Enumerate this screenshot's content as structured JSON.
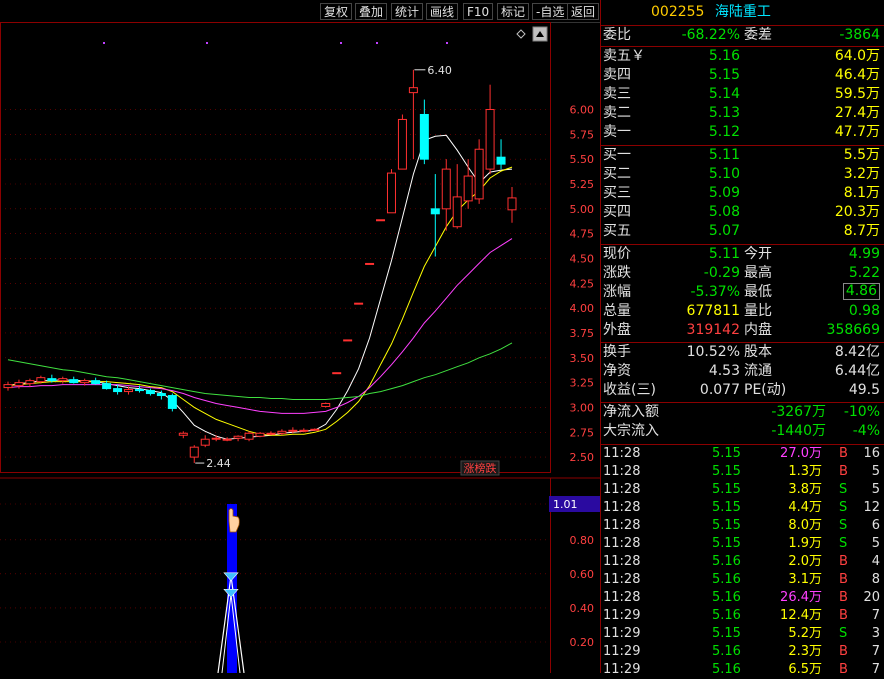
{
  "toolbar": {
    "buttons": [
      "复权",
      "叠加",
      "统计",
      "画线",
      "F10",
      "标记",
      "-自选",
      "返回"
    ]
  },
  "stock": {
    "code": "002255",
    "name": "海陆重工"
  },
  "weibi": {
    "label1": "委比",
    "value1": "-68.22%",
    "label2": "委差",
    "value2": "-3864"
  },
  "sell": [
    {
      "label": "卖五￥",
      "price": "5.16",
      "vol": "64.0万"
    },
    {
      "label": "卖四",
      "price": "5.15",
      "vol": "46.4万"
    },
    {
      "label": "卖三",
      "price": "5.14",
      "vol": "59.5万"
    },
    {
      "label": "卖二",
      "price": "5.13",
      "vol": "27.4万"
    },
    {
      "label": "卖一",
      "price": "5.12",
      "vol": "47.7万"
    }
  ],
  "buy": [
    {
      "label": "买一",
      "price": "5.11",
      "vol": "5.5万"
    },
    {
      "label": "买二",
      "price": "5.10",
      "vol": "3.2万"
    },
    {
      "label": "买三",
      "price": "5.09",
      "vol": "8.1万"
    },
    {
      "label": "买四",
      "price": "5.08",
      "vol": "20.3万"
    },
    {
      "label": "买五",
      "price": "5.07",
      "vol": "8.7万"
    }
  ],
  "quote": [
    {
      "l1": "现价",
      "v1": "5.11",
      "c1": "g",
      "l2": "今开",
      "v2": "4.99",
      "c2": "g"
    },
    {
      "l1": "涨跌",
      "v1": "-0.29",
      "c1": "g",
      "l2": "最高",
      "v2": "5.22",
      "c2": "g"
    },
    {
      "l1": "涨幅",
      "v1": "-5.37%",
      "c1": "g",
      "l2": "最低",
      "v2": "4.86",
      "c2": "g"
    },
    {
      "l1": "总量",
      "v1": "677811",
      "c1": "y",
      "l2": "量比",
      "v2": "0.98",
      "c2": "g"
    },
    {
      "l1": "外盘",
      "v1": "319142",
      "c1": "r",
      "l2": "内盘",
      "v2": "358669",
      "c2": "g"
    }
  ],
  "fund": [
    {
      "l1": "换手",
      "v1": "10.52%",
      "l2": "股本",
      "v2": "8.42亿"
    },
    {
      "l1": "净资",
      "v1": "4.53",
      "l2": "流通",
      "v2": "6.44亿"
    },
    {
      "l1": "收益(三)",
      "v1": "0.077",
      "l2": "PE(动)",
      "v2": "49.5"
    }
  ],
  "flow": [
    {
      "label": "净流入额",
      "value": "-3267万",
      "pct": "-10%"
    },
    {
      "label": "大宗流入",
      "value": "-1440万",
      "pct": "-4%"
    }
  ],
  "ticks": [
    {
      "t": "11:28",
      "p": "5.15",
      "v": "27.0万",
      "vc": "m",
      "s": "B",
      "n": "16"
    },
    {
      "t": "11:28",
      "p": "5.15",
      "v": "1.3万",
      "vc": "y",
      "s": "B",
      "n": "5"
    },
    {
      "t": "11:28",
      "p": "5.15",
      "v": "3.8万",
      "vc": "y",
      "s": "S",
      "n": "5"
    },
    {
      "t": "11:28",
      "p": "5.15",
      "v": "4.4万",
      "vc": "y",
      "s": "S",
      "n": "12"
    },
    {
      "t": "11:28",
      "p": "5.15",
      "v": "8.0万",
      "vc": "y",
      "s": "S",
      "n": "6"
    },
    {
      "t": "11:28",
      "p": "5.15",
      "v": "1.9万",
      "vc": "y",
      "s": "S",
      "n": "5"
    },
    {
      "t": "11:28",
      "p": "5.16",
      "v": "2.0万",
      "vc": "y",
      "s": "B",
      "n": "4"
    },
    {
      "t": "11:28",
      "p": "5.16",
      "v": "3.1万",
      "vc": "y",
      "s": "B",
      "n": "8"
    },
    {
      "t": "11:28",
      "p": "5.16",
      "v": "26.4万",
      "vc": "m",
      "s": "B",
      "n": "20"
    },
    {
      "t": "11:29",
      "p": "5.16",
      "v": "12.4万",
      "vc": "y",
      "s": "B",
      "n": "7"
    },
    {
      "t": "11:29",
      "p": "5.15",
      "v": "5.2万",
      "vc": "y",
      "s": "S",
      "n": "3"
    },
    {
      "t": "11:29",
      "p": "5.16",
      "v": "2.3万",
      "vc": "y",
      "s": "B",
      "n": "7"
    },
    {
      "t": "11:29",
      "p": "5.16",
      "v": "6.5万",
      "vc": "y",
      "s": "B",
      "n": "7"
    }
  ],
  "chart_data": {
    "type": "candlestick",
    "price_axis": [
      "6.00",
      "5.75",
      "5.50",
      "5.25",
      "5.00",
      "4.75",
      "4.50",
      "4.25",
      "4.00",
      "3.75",
      "3.50",
      "3.25",
      "3.00",
      "2.75",
      "2.50"
    ],
    "high_label": "6.40",
    "low_label": "2.44",
    "tag": "涨榜跌",
    "candles": [
      {
        "o": 3.2,
        "h": 3.26,
        "l": 3.17,
        "c": 3.23
      },
      {
        "o": 3.22,
        "h": 3.28,
        "l": 3.19,
        "c": 3.25
      },
      {
        "o": 3.24,
        "h": 3.29,
        "l": 3.21,
        "c": 3.27
      },
      {
        "o": 3.26,
        "h": 3.32,
        "l": 3.24,
        "c": 3.3
      },
      {
        "o": 3.29,
        "h": 3.33,
        "l": 3.25,
        "c": 3.27
      },
      {
        "o": 3.27,
        "h": 3.31,
        "l": 3.24,
        "c": 3.29
      },
      {
        "o": 3.28,
        "h": 3.31,
        "l": 3.24,
        "c": 3.25
      },
      {
        "o": 3.25,
        "h": 3.29,
        "l": 3.22,
        "c": 3.27
      },
      {
        "o": 3.27,
        "h": 3.3,
        "l": 3.23,
        "c": 3.24
      },
      {
        "o": 3.24,
        "h": 3.27,
        "l": 3.18,
        "c": 3.19
      },
      {
        "o": 3.19,
        "h": 3.23,
        "l": 3.13,
        "c": 3.16
      },
      {
        "o": 3.16,
        "h": 3.21,
        "l": 3.13,
        "c": 3.18
      },
      {
        "o": 3.18,
        "h": 3.22,
        "l": 3.15,
        "c": 3.17
      },
      {
        "o": 3.17,
        "h": 3.19,
        "l": 3.12,
        "c": 3.14
      },
      {
        "o": 3.14,
        "h": 3.17,
        "l": 3.08,
        "c": 3.12
      },
      {
        "o": 3.12,
        "h": 3.14,
        "l": 2.96,
        "c": 2.99
      },
      {
        "o": 2.72,
        "h": 2.76,
        "l": 2.69,
        "c": 2.74
      },
      {
        "o": 2.5,
        "h": 2.62,
        "l": 2.44,
        "c": 2.6
      },
      {
        "o": 2.62,
        "h": 2.72,
        "l": 2.6,
        "c": 2.68
      },
      {
        "o": 2.69,
        "h": 2.72,
        "l": 2.66,
        "c": 2.69
      },
      {
        "o": 2.68,
        "h": 2.7,
        "l": 2.66,
        "c": 2.68
      },
      {
        "o": 2.69,
        "h": 2.72,
        "l": 2.66,
        "c": 2.71
      },
      {
        "o": 2.68,
        "h": 2.76,
        "l": 2.66,
        "c": 2.74
      },
      {
        "o": 2.71,
        "h": 2.75,
        "l": 2.7,
        "c": 2.74
      },
      {
        "o": 2.74,
        "h": 2.76,
        "l": 2.72,
        "c": 2.74
      },
      {
        "o": 2.74,
        "h": 2.78,
        "l": 2.72,
        "c": 2.76
      },
      {
        "o": 2.76,
        "h": 2.8,
        "l": 2.74,
        "c": 2.77
      },
      {
        "o": 2.77,
        "h": 2.79,
        "l": 2.75,
        "c": 2.77
      },
      {
        "o": 2.78,
        "h": 2.79,
        "l": 2.77,
        "c": 2.78
      },
      {
        "o": 3.01,
        "h": 3.05,
        "l": 3.0,
        "c": 3.04
      },
      {
        "o": 3.35,
        "h": 3.35,
        "l": 3.35,
        "c": 3.35
      },
      {
        "o": 3.68,
        "h": 3.68,
        "l": 3.68,
        "c": 3.68
      },
      {
        "o": 4.05,
        "h": 4.05,
        "l": 4.05,
        "c": 4.05
      },
      {
        "o": 4.45,
        "h": 4.45,
        "l": 4.45,
        "c": 4.45
      },
      {
        "o": 4.89,
        "h": 4.89,
        "l": 4.89,
        "c": 4.89
      },
      {
        "o": 4.96,
        "h": 5.4,
        "l": 4.96,
        "c": 5.36
      },
      {
        "o": 5.4,
        "h": 5.95,
        "l": 5.4,
        "c": 5.9
      },
      {
        "o": 6.17,
        "h": 6.4,
        "l": 5.5,
        "c": 6.22
      },
      {
        "o": 5.95,
        "h": 6.1,
        "l": 5.45,
        "c": 5.5
      },
      {
        "o": 5.0,
        "h": 5.35,
        "l": 4.52,
        "c": 4.95
      },
      {
        "o": 5.0,
        "h": 5.5,
        "l": 4.78,
        "c": 5.4
      },
      {
        "o": 4.82,
        "h": 5.45,
        "l": 4.8,
        "c": 5.12
      },
      {
        "o": 5.08,
        "h": 5.5,
        "l": 5.0,
        "c": 5.33
      },
      {
        "o": 5.1,
        "h": 5.7,
        "l": 5.05,
        "c": 5.6
      },
      {
        "o": 5.4,
        "h": 6.25,
        "l": 5.35,
        "c": 6.0
      },
      {
        "o": 5.52,
        "h": 5.7,
        "l": 5.4,
        "c": 5.45
      },
      {
        "o": 4.99,
        "h": 5.22,
        "l": 4.86,
        "c": 5.11
      }
    ],
    "ma": [
      {
        "name": "MA5",
        "color": "#ffffff",
        "values": [
          3.22,
          3.24,
          3.25,
          3.27,
          3.27,
          3.28,
          3.27,
          3.27,
          3.26,
          3.24,
          3.22,
          3.2,
          3.19,
          3.17,
          3.15,
          3.07,
          2.95,
          2.82,
          2.76,
          2.71,
          2.68,
          2.69,
          2.7,
          2.71,
          2.72,
          2.74,
          2.75,
          2.76,
          2.77,
          2.83,
          2.98,
          3.17,
          3.39,
          3.7,
          4.09,
          4.48,
          4.91,
          5.35,
          5.69,
          5.73,
          5.74,
          5.59,
          5.42,
          5.26,
          5.37,
          5.39,
          5.4
        ]
      },
      {
        "name": "MA10",
        "color": "#ffff00",
        "values": [
          3.22,
          3.23,
          3.24,
          3.25,
          3.26,
          3.26,
          3.26,
          3.26,
          3.26,
          3.26,
          3.25,
          3.24,
          3.23,
          3.21,
          3.2,
          3.16,
          3.08,
          3.0,
          2.94,
          2.88,
          2.84,
          2.8,
          2.76,
          2.73,
          2.72,
          2.72,
          2.73,
          2.73,
          2.75,
          2.78,
          2.86,
          2.95,
          3.06,
          3.22,
          3.43,
          3.64,
          3.89,
          4.16,
          4.42,
          4.62,
          4.82,
          4.98,
          5.09,
          5.18,
          5.31,
          5.38,
          5.42
        ]
      },
      {
        "name": "MA20",
        "color": "#ff40ff",
        "values": [
          3.2,
          3.21,
          3.21,
          3.22,
          3.22,
          3.23,
          3.23,
          3.23,
          3.23,
          3.23,
          3.23,
          3.22,
          3.21,
          3.2,
          3.19,
          3.17,
          3.14,
          3.1,
          3.07,
          3.04,
          3.02,
          3.0,
          2.98,
          2.96,
          2.95,
          2.94,
          2.94,
          2.94,
          2.95,
          2.96,
          3.0,
          3.05,
          3.11,
          3.2,
          3.31,
          3.43,
          3.56,
          3.7,
          3.85,
          3.97,
          4.1,
          4.23,
          4.34,
          4.45,
          4.56,
          4.63,
          4.7
        ]
      },
      {
        "name": "MA60",
        "color": "#40e040",
        "values": [
          3.48,
          3.46,
          3.44,
          3.42,
          3.4,
          3.38,
          3.37,
          3.35,
          3.33,
          3.31,
          3.3,
          3.28,
          3.26,
          3.24,
          3.22,
          3.2,
          3.18,
          3.16,
          3.14,
          3.13,
          3.12,
          3.11,
          3.1,
          3.1,
          3.09,
          3.09,
          3.08,
          3.08,
          3.08,
          3.08,
          3.09,
          3.1,
          3.11,
          3.14,
          3.16,
          3.19,
          3.22,
          3.26,
          3.3,
          3.33,
          3.37,
          3.41,
          3.45,
          3.5,
          3.54,
          3.59,
          3.65
        ]
      }
    ],
    "indicator": {
      "axis": [
        "1.01",
        "0.80",
        "0.60",
        "0.40",
        "0.20"
      ],
      "current": "1.01"
    }
  }
}
